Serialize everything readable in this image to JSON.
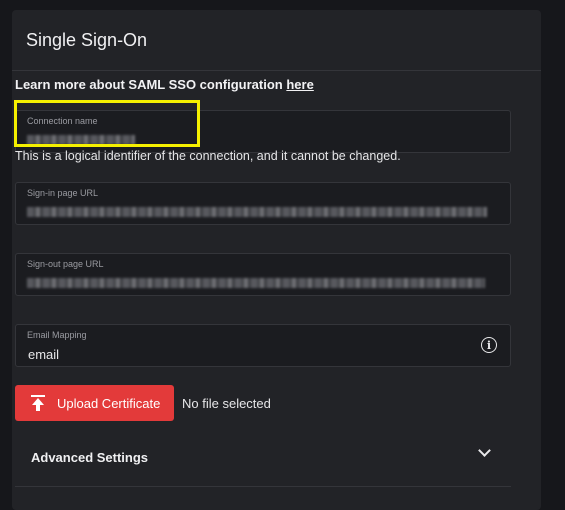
{
  "panel": {
    "title": "Single Sign-On",
    "learn_more_text": "Learn more about SAML SSO configuration ",
    "learn_more_link": "here"
  },
  "fields": {
    "connection_name": {
      "label": "Connection name",
      "value": ""
    },
    "connection_hint": "This is a logical identifier of the connection, and it cannot be changed.",
    "sign_in_url": {
      "label": "Sign-in page URL",
      "value": ""
    },
    "sign_out_url": {
      "label": "Sign-out page URL",
      "value": ""
    },
    "email_mapping": {
      "label": "Email Mapping",
      "value": "email",
      "icon": "info-icon"
    }
  },
  "upload": {
    "button_label": "Upload Certificate",
    "icon": "upload-icon",
    "status": "No file selected"
  },
  "advanced": {
    "label": "Advanced Settings",
    "icon": "chevron-down-icon"
  },
  "colors": {
    "accent_button": "#e33a3a",
    "highlight": "#f5f000",
    "panel_bg": "#222327"
  }
}
